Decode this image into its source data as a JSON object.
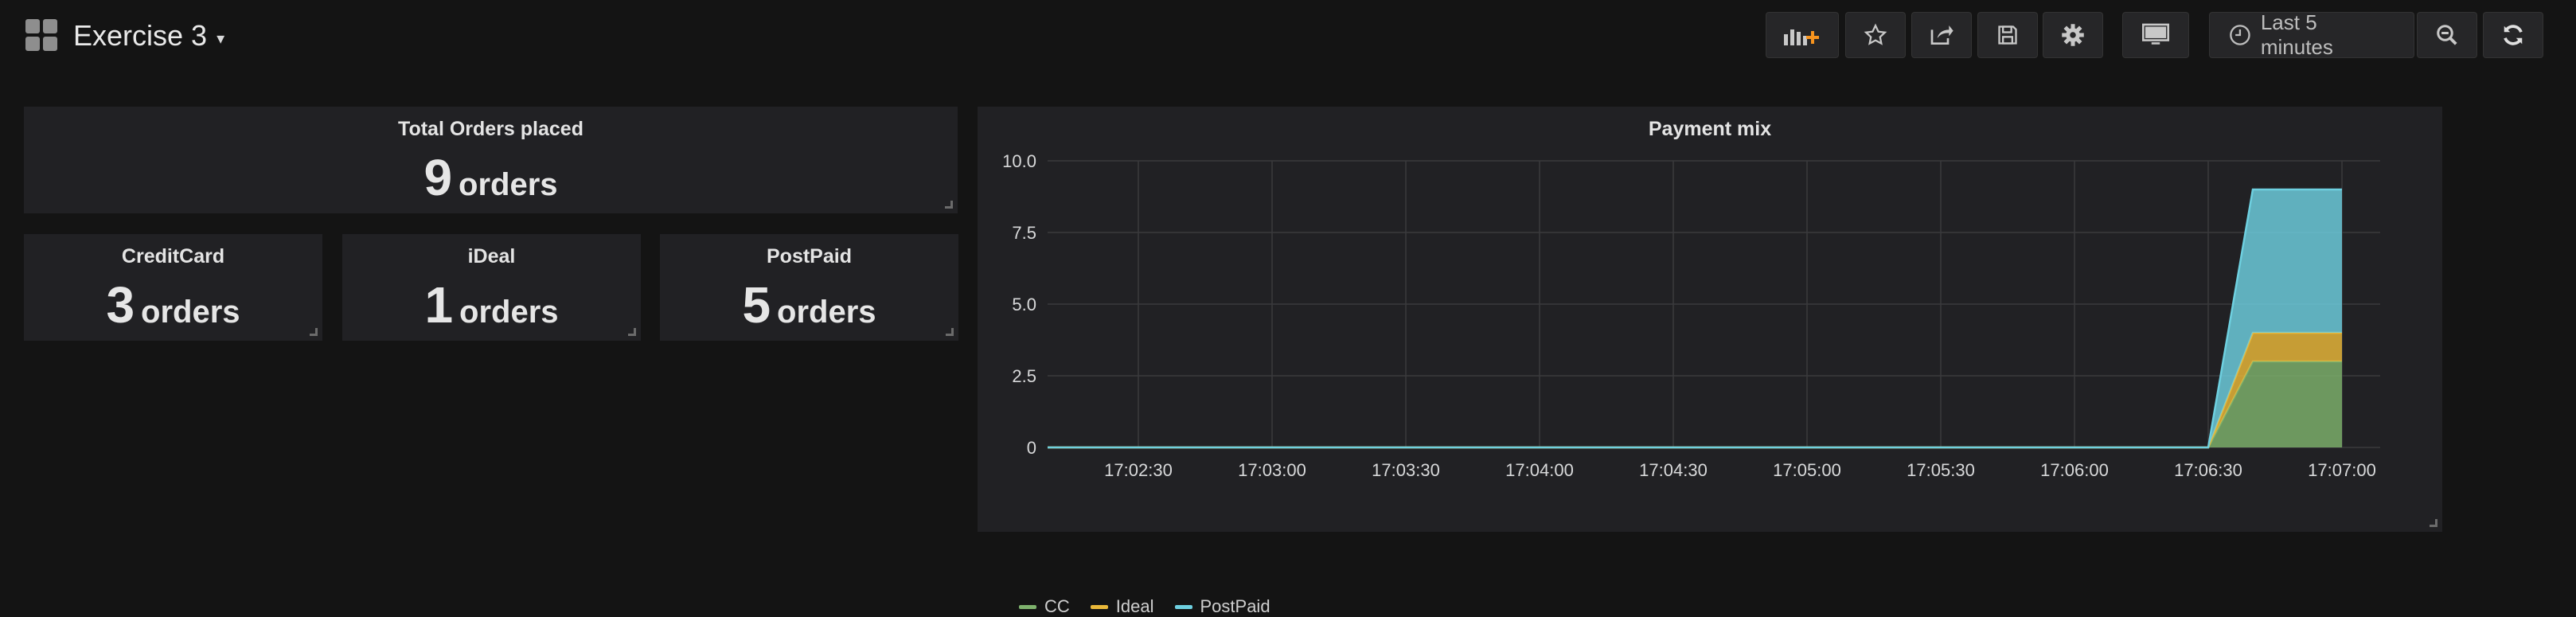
{
  "dashboard": {
    "title": "Exercise 3"
  },
  "toolbar": {
    "time_range": "Last 5 minutes"
  },
  "panels": {
    "total": {
      "title": "Total Orders placed",
      "value": "9",
      "unit": "orders"
    },
    "cc": {
      "title": "CreditCard",
      "value": "3",
      "unit": "orders"
    },
    "ideal": {
      "title": "iDeal",
      "value": "1",
      "unit": "orders"
    },
    "postpaid": {
      "title": "PostPaid",
      "value": "5",
      "unit": "orders"
    }
  },
  "graph": {
    "title": "Payment mix"
  },
  "colors": {
    "cc": "#7eb26d",
    "ideal": "#eab839",
    "postpaid": "#6ed0e0",
    "accent": "#f7941e"
  },
  "chart_data": {
    "type": "area",
    "stacked": true,
    "title": "Payment mix",
    "x": [
      "17:02:30",
      "17:03:00",
      "17:03:30",
      "17:04:00",
      "17:04:30",
      "17:05:00",
      "17:05:30",
      "17:06:00",
      "17:06:30",
      "17:06:40",
      "17:07:00"
    ],
    "x_ticks": [
      "17:02:30",
      "17:03:00",
      "17:03:30",
      "17:04:00",
      "17:04:30",
      "17:05:00",
      "17:05:30",
      "17:06:00",
      "17:06:30",
      "17:07:00"
    ],
    "y_ticks": [
      "0",
      "2.5",
      "5.0",
      "7.5",
      "10.0"
    ],
    "ylim": [
      0,
      10
    ],
    "series": [
      {
        "name": "CC",
        "values": [
          0,
          0,
          0,
          0,
          0,
          0,
          0,
          0,
          0,
          3,
          3
        ]
      },
      {
        "name": "Ideal",
        "values": [
          0,
          0,
          0,
          0,
          0,
          0,
          0,
          0,
          0,
          1,
          1
        ]
      },
      {
        "name": "PostPaid",
        "values": [
          0,
          0,
          0,
          0,
          0,
          0,
          0,
          0,
          0,
          5,
          5
        ]
      }
    ],
    "grid": true,
    "legend": "bottom-left"
  }
}
